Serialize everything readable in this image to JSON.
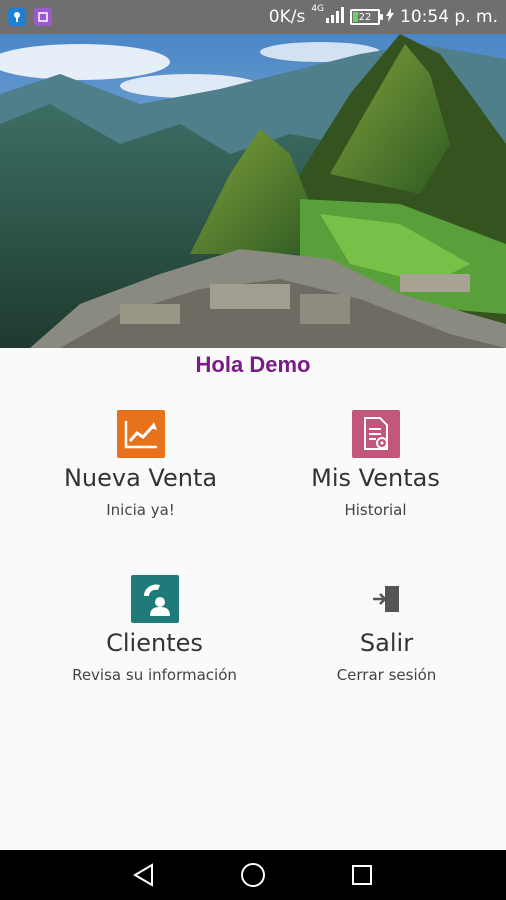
{
  "status_bar": {
    "network_speed": "0K/s",
    "network_type": "4G",
    "battery_level": "22",
    "time": "10:54 p. m."
  },
  "greeting": "Hola Demo",
  "menu": [
    {
      "title": "Nueva Venta",
      "subtitle": "Inicia ya!",
      "icon": "chart-up-icon",
      "color": "#e8711c"
    },
    {
      "title": "Mis Ventas",
      "subtitle": "Historial",
      "icon": "document-gear-icon",
      "color": "#c2577a"
    },
    {
      "title": "Clientes",
      "subtitle": "Revisa su información",
      "icon": "contact-phone-icon",
      "color": "#1f7a7a"
    },
    {
      "title": "Salir",
      "subtitle": "Cerrar sesión",
      "icon": "logout-door-icon",
      "color": "#555555"
    }
  ],
  "nav": [
    "back-icon",
    "home-icon",
    "recents-icon"
  ]
}
